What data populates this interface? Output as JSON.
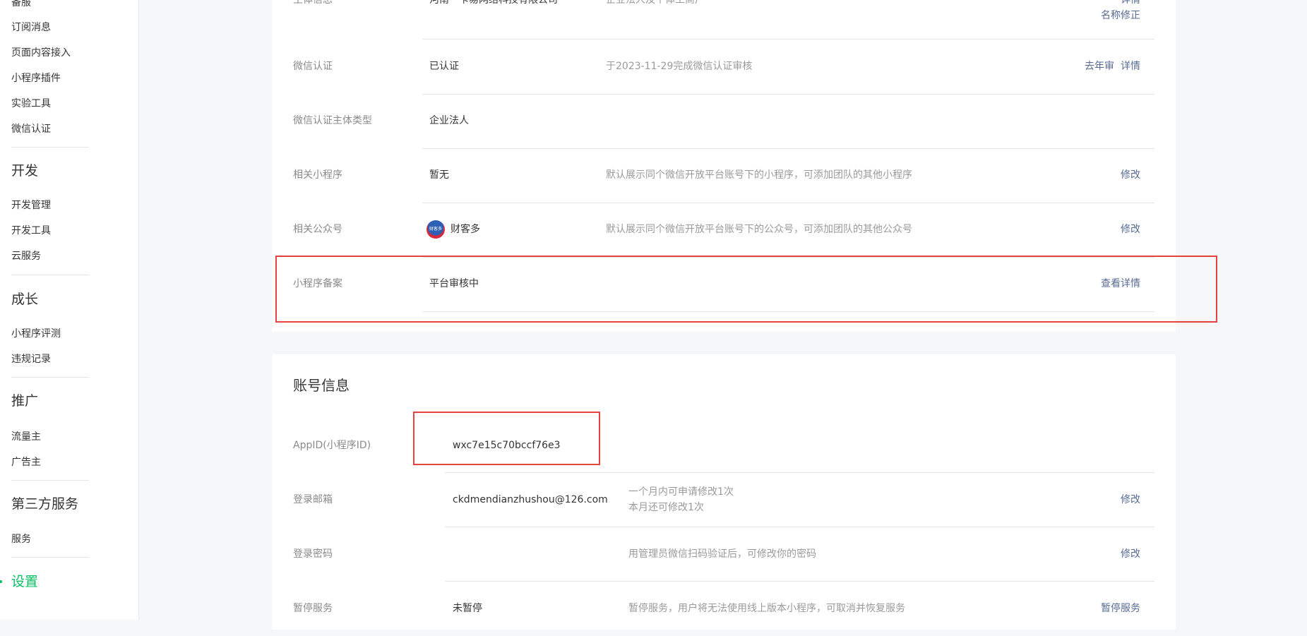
{
  "sidebar": {
    "items_top": [
      "备服",
      "订阅消息",
      "页面内容接入",
      "小程序插件",
      "实验工具",
      "微信认证"
    ],
    "dev_header": "开发",
    "dev_items": [
      "开发管理",
      "开发工具",
      "云服务"
    ],
    "growth_header": "成长",
    "growth_items": [
      "小程序评测",
      "违规记录"
    ],
    "promo_header": "推广",
    "promo_items": [
      "流量主",
      "广告主"
    ],
    "thirdparty_header": "第三方服务",
    "thirdparty_items": [
      "服务"
    ],
    "settings_header": "设置"
  },
  "basic_info": {
    "rows": [
      {
        "label": "主体信息",
        "value": "河南一卡易网络科技有限公司",
        "desc": "企业法人及个体工商户",
        "actions": [
          "详情",
          "名称修正"
        ]
      },
      {
        "label": "微信认证",
        "value": "已认证",
        "desc": "于2023-11-29完成微信认证审核",
        "actions": [
          "去年审",
          "详情"
        ]
      },
      {
        "label": "微信认证主体类型",
        "value": "企业法人"
      },
      {
        "label": "相关小程序",
        "value": "暂无",
        "desc": "默认展示同个微信开放平台账号下的小程序，可添加团队的其他小程序",
        "actions": [
          "修改"
        ]
      },
      {
        "label": "相关公众号",
        "value": "财客多",
        "avatar_text": "财客多",
        "desc": "默认展示同个微信开放平台账号下的公众号，可添加团队的其他公众号",
        "actions": [
          "修改"
        ]
      },
      {
        "label": "小程序备案",
        "value": "平台审核中",
        "actions": [
          "查看详情"
        ]
      }
    ]
  },
  "account_info": {
    "title": "账号信息",
    "rows": [
      {
        "label": "AppID(小程序ID)",
        "value": "wxc7e15c70bccf76e3"
      },
      {
        "label": "登录邮箱",
        "value": "ckdmendianzhushou@126.com",
        "desc_line1": "一个月内可申请修改1次",
        "desc_line2": "本月还可修改1次",
        "actions": [
          "修改"
        ]
      },
      {
        "label": "登录密码",
        "value": "",
        "desc": "用管理员微信扫码验证后，可修改你的密码",
        "actions": [
          "修改"
        ]
      },
      {
        "label": "暂停服务",
        "value": "未暂停",
        "desc": "暂停服务，用户将无法使用线上版本小程序，可取消并恢复服务",
        "actions": [
          "暂停服务"
        ]
      }
    ]
  },
  "colors": {
    "accent_green": "#07c160",
    "link_blue": "#576b95",
    "highlight_red": "#e64340"
  }
}
